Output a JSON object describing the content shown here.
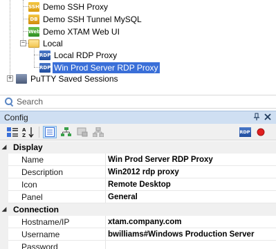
{
  "tree": {
    "items": [
      {
        "label": "Demo SSH Proxy",
        "icon": "ssh-icon",
        "glyph": "SSH"
      },
      {
        "label": "Demo SSH Tunnel MySQL",
        "icon": "database-icon",
        "glyph": "DB"
      },
      {
        "label": "Demo XTAM Web UI",
        "icon": "web-icon",
        "glyph": "Web"
      },
      {
        "label": "Local",
        "icon": "folder-icon",
        "glyph": ""
      },
      {
        "label": "Local RDP Proxy",
        "icon": "rdp-icon",
        "glyph": "RDP"
      },
      {
        "label": "Win Prod Server RDP Proxy",
        "icon": "rdp-icon",
        "glyph": "RDP"
      },
      {
        "label": "PuTTY Saved Sessions",
        "icon": "putty-icon",
        "glyph": ""
      }
    ],
    "selected_index": 5
  },
  "search": {
    "placeholder": "Search"
  },
  "panel": {
    "title": "Config",
    "pin_glyph": "⌕",
    "close_glyph": "✕"
  },
  "toolbar": {
    "rdp_badge": "RDP"
  },
  "properties": {
    "display": {
      "category": "Display",
      "rows": [
        {
          "name": "Name",
          "value": "Win Prod Server RDP Proxy"
        },
        {
          "name": "Description",
          "value": "Win2012 rdp proxy"
        },
        {
          "name": "Icon",
          "value": "Remote Desktop"
        },
        {
          "name": "Panel",
          "value": "General"
        }
      ]
    },
    "connection": {
      "category": "Connection",
      "rows": [
        {
          "name": "Hostname/IP",
          "value": "xtam.company.com"
        },
        {
          "name": "Username",
          "value": "bwilliams#Windows Production Server"
        },
        {
          "name": "Password",
          "value": ""
        }
      ]
    }
  },
  "colors": {
    "selection": "#3a6fd8",
    "panel_header": "#cfdff2",
    "record_red": "#e02020"
  }
}
